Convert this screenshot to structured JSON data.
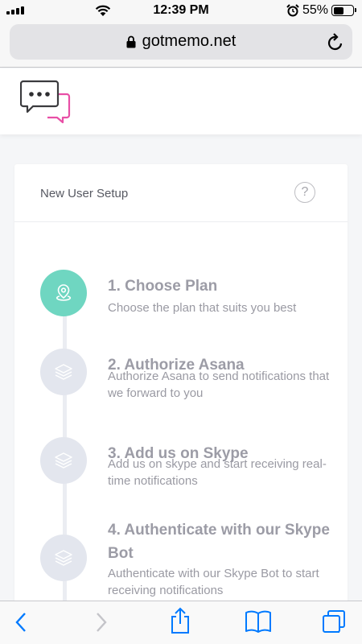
{
  "status": {
    "time": "12:39 PM",
    "battery_percent": "55%",
    "battery_level": 0.55
  },
  "browser": {
    "url": "gotmemo.net"
  },
  "card": {
    "title": "New User Setup",
    "help_label": "?"
  },
  "steps": [
    {
      "title": "1. Choose Plan",
      "description": "Choose the plan that suits you best",
      "icon": "map-pin-icon",
      "active": true
    },
    {
      "title": "2. Authorize Asana",
      "description": "Authorize Asana to send notifications that we forward to you",
      "icon": "layers-icon",
      "active": false
    },
    {
      "title": "3. Add us on Skype",
      "description": "Add us on skype and start receiving real-time notifications",
      "icon": "layers-icon",
      "active": false
    },
    {
      "title": "4. Authenticate with our Skype Bot",
      "description": "Authenticate with our Skype Bot to start receiving notifications",
      "icon": "layers-icon",
      "active": false
    }
  ],
  "colors": {
    "accent": "#6fd6c1",
    "inactive_step": "#e3e6ee",
    "ios_blue": "#007aff",
    "logo_pink": "#e84fa6"
  }
}
